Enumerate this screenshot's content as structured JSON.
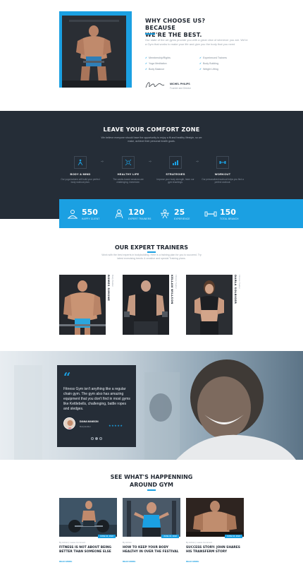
{
  "why": {
    "title_line1": "WHY CHOOSE US? BECAUSE",
    "title_line2": "WE'RE THE BEST.",
    "description": "Our state of the art gyms provide you with a great view of wherever you are. We're a Gym that works to make your life and give you the body that you need",
    "features": [
      "Membership/Rights",
      "Experienced Trainers",
      "Yoga Meditation",
      "Body Building",
      "Body Balance",
      "Weight Lifting"
    ],
    "signature_name": "MICHEL PHILIPS",
    "signature_role": "Founder and Director"
  },
  "comfort": {
    "title": "LEAVE YOUR COMFORT ZONE",
    "subtitle": "We believe everyone should have the opportunity to enjoy a fit and healthy lifestyle, so we make, achieve their personal health goals.",
    "steps": [
      {
        "icon": "body-mind-icon",
        "title": "BODY & MIND",
        "desc": "Our yoga trainers will build your perfect body workout plan."
      },
      {
        "icon": "healthy-life-icon",
        "title": "HEALTHY LIFE",
        "desc": "The cardio-based sessions are challenging, immersive."
      },
      {
        "icon": "strategies-icon",
        "title": "STRATEGIES",
        "desc": "Improve your body strength, learn our gym teachings."
      },
      {
        "icon": "workout-icon",
        "title": "WORKOUT",
        "desc": "Our personalized workout helps you find a perfect workout."
      }
    ]
  },
  "stats": [
    {
      "icon": "happy-clients-icon",
      "value": "550",
      "label": "HAPPY CLIENT"
    },
    {
      "icon": "expert-trainers-icon",
      "value": "120",
      "label": "EXPERT TRAINERS"
    },
    {
      "icon": "experience-icon",
      "value": "25",
      "label": "EXPERIENCE"
    },
    {
      "icon": "total-branch-icon",
      "value": "150",
      "label": "TOTAL BRANCH"
    }
  ],
  "trainers": {
    "title": "OUR EXPERT TRAINERS",
    "subtitle": "Work with the best experts in bodybuilding. Here is a training plan for you to succeed. Try latest exercising trends & creative and special Training plans.",
    "items": [
      {
        "name": "ROMES SIMONE",
        "role": "Body Builder"
      },
      {
        "name": "KELLAN WILLSON",
        "role": "Fitness Trainer"
      },
      {
        "name": "DARLA SOLBIGER",
        "role": "Fitness Trainer"
      }
    ]
  },
  "testimonial": {
    "quote_mark": "“",
    "text": "Fitness Gym isn't anything like a regular chain gym. The gym also has amazing equipment that you don't find in most gyms like Kettlebells, challenging, battle ropes and sledges.",
    "name": "DIANA MANSON",
    "role": "Bodybuilder",
    "stars": "★★★★★"
  },
  "blog": {
    "title_line1": "SEE WHAT'S HAPPENNING",
    "title_line2": "AROUND GYM",
    "posts": [
      {
        "date": "JUNE 16, 2022",
        "meta": "By Admin  |  Leave Comment",
        "title": "FITNESS IS NOT ABOUT BEING BETTER THAN SOMEONE ELSE",
        "more": "READ MORE"
      },
      {
        "date": "JUNE 16, 2022",
        "meta": "By Admin",
        "title": "HOW TO KEEP YOUR BODY HEALTHY IN OVER THE FESTIVAL",
        "more": "READ MORE"
      },
      {
        "date": "JUNE 16, 2022",
        "meta": "By Admin  |  Leave Comment",
        "title": "SUCCESS STORY: JOHN SHARES HIS TRANSFERM STORY",
        "more": "READ MORE"
      }
    ]
  },
  "colors": {
    "accent": "#1ba0e2",
    "dark": "#252d37"
  }
}
